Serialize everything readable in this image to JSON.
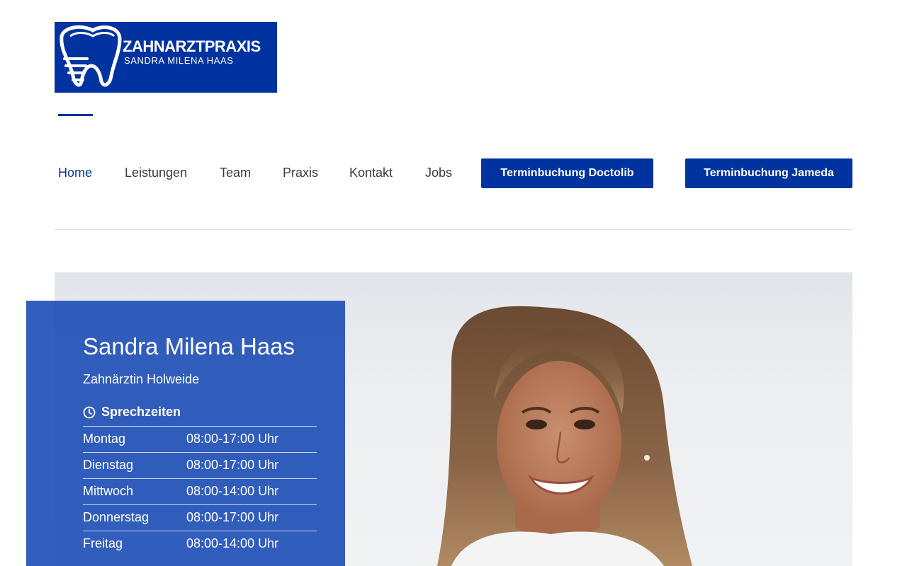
{
  "logo": {
    "title": "ZAHNARZTPRAXIS",
    "subtitle": "SANDRA MILENA HAAS",
    "background": "#0033a0",
    "icon": "tooth-implant-icon"
  },
  "nav": {
    "items": [
      {
        "label": "Home",
        "active": true
      },
      {
        "label": "Leistungen",
        "active": false
      },
      {
        "label": "Team",
        "active": false
      },
      {
        "label": "Praxis",
        "active": false
      },
      {
        "label": "Kontakt",
        "active": false
      },
      {
        "label": "Jobs",
        "active": false
      }
    ],
    "buttons": [
      {
        "label": "Terminbuchung Doctolib"
      },
      {
        "label": "Terminbuchung Jameda"
      }
    ]
  },
  "hero": {
    "name": "Sandra Milena Haas",
    "subtitle": "Zahnärztin Holweide",
    "hours_title": "Sprechzeiten",
    "hours_icon": "clock-icon",
    "hours": [
      {
        "day": "Montag",
        "time": "08:00-17:00 Uhr"
      },
      {
        "day": "Dienstag",
        "time": "08:00-17:00 Uhr"
      },
      {
        "day": "Mittwoch",
        "time": "08:00-14:00 Uhr"
      },
      {
        "day": "Donnerstag",
        "time": "08:00-17:00 Uhr"
      },
      {
        "day": "Freitag",
        "time": "08:00-14:00 Uhr"
      }
    ],
    "photo": "portrait-photo"
  },
  "colors": {
    "brand": "#0033a0",
    "panel": "#1648b4",
    "nav_text": "#3a3a3a"
  }
}
